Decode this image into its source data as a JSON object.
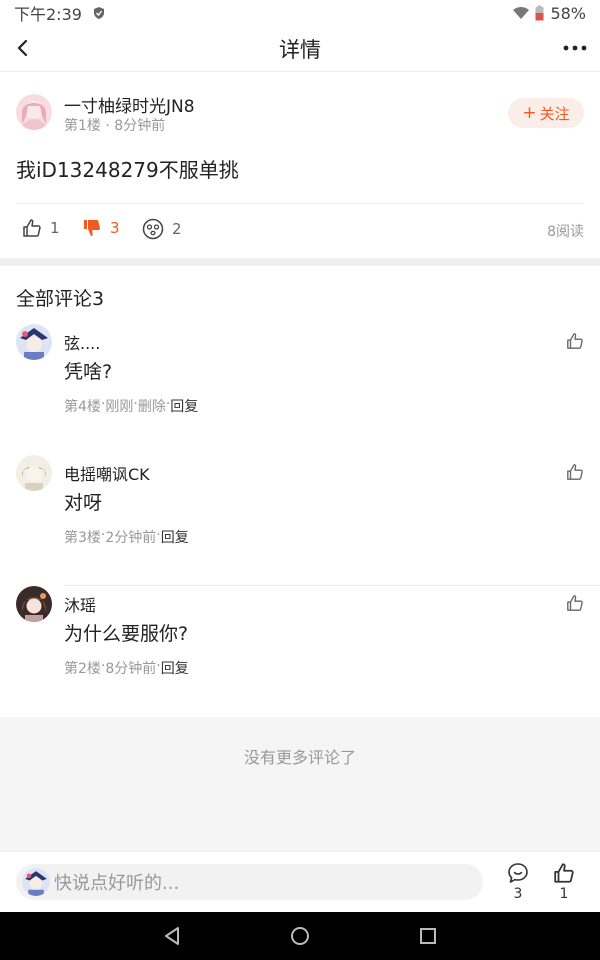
{
  "status_bar": {
    "time": "下午2:39",
    "battery": "58%"
  },
  "header": {
    "title": "详情"
  },
  "post": {
    "author": "一寸柚绿时光JN8",
    "floor": "第1楼",
    "sep": " · ",
    "time": "8分钟前",
    "follow_label": "关注",
    "follow_plus": "+",
    "content": "我iD13248279不服单挑",
    "likes": "1",
    "dislikes": "3",
    "emojis": "2",
    "reads": "8阅读"
  },
  "comments_title": "全部评论3",
  "comments": [
    {
      "name": "弦....",
      "text": "凭啥?",
      "floor": "第4楼",
      "time": "刚刚",
      "delete": "删除",
      "reply": "回复",
      "sep": " · "
    },
    {
      "name": "电摇嘲讽CK",
      "text": "对呀",
      "floor": "第3楼",
      "time": "2分钟前",
      "reply": "回复",
      "sep": " · "
    },
    {
      "name": "沐瑶",
      "text": "为什么要服你?",
      "floor": "第2楼",
      "time": "8分钟前",
      "reply": "回复",
      "sep": " · "
    }
  ],
  "no_more": "没有更多评论了",
  "bottom_bar": {
    "placeholder": "快说点好听的...",
    "comment_count": "3",
    "like_count": "1"
  },
  "colors": {
    "accent": "#f05a1f",
    "muted": "#999999"
  }
}
